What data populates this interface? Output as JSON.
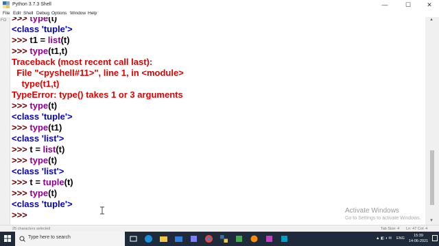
{
  "window": {
    "title": "Python 3.7.3 Shell",
    "minimize": "—",
    "maximize": "☐",
    "close": "✕"
  },
  "menu": [
    "File",
    "Edit",
    "Shell",
    "Debug",
    "Options",
    "Window",
    "Help"
  ],
  "gutter_text": "FO",
  "shell": {
    "lines": [
      {
        "segments": [
          {
            "t": ">>> ",
            "c": "prompt"
          },
          {
            "t": "type",
            "c": "builtin"
          },
          {
            "t": "(t)",
            "c": "code"
          }
        ]
      },
      {
        "segments": [
          {
            "t": "<class 'tuple'>",
            "c": "out"
          }
        ]
      },
      {
        "segments": [
          {
            "t": ">>> ",
            "c": "prompt"
          },
          {
            "t": "t1 = ",
            "c": "code"
          },
          {
            "t": "list",
            "c": "builtin"
          },
          {
            "t": "(t)",
            "c": "code"
          }
        ]
      },
      {
        "segments": [
          {
            "t": ">>> ",
            "c": "prompt"
          },
          {
            "t": "type",
            "c": "builtin"
          },
          {
            "t": "(t1,t)",
            "c": "code"
          }
        ]
      },
      {
        "segments": [
          {
            "t": "Traceback (most recent call last):",
            "c": "err"
          }
        ]
      },
      {
        "segments": [
          {
            "t": "  File \"<pyshell#11>\", line 1, in <module>",
            "c": "err"
          }
        ]
      },
      {
        "segments": [
          {
            "t": "    type(t1,t)",
            "c": "err"
          }
        ]
      },
      {
        "segments": [
          {
            "t": "TypeError: type() takes 1 or 3 arguments",
            "c": "err"
          }
        ]
      },
      {
        "segments": [
          {
            "t": ">>> ",
            "c": "prompt"
          },
          {
            "t": "type",
            "c": "builtin"
          },
          {
            "t": "(t)",
            "c": "code"
          }
        ]
      },
      {
        "segments": [
          {
            "t": "<class 'tuple'>",
            "c": "out"
          }
        ]
      },
      {
        "segments": [
          {
            "t": ">>> ",
            "c": "prompt"
          },
          {
            "t": "type",
            "c": "builtin"
          },
          {
            "t": "(t1)",
            "c": "code"
          }
        ]
      },
      {
        "segments": [
          {
            "t": "<class 'list'>",
            "c": "out"
          }
        ]
      },
      {
        "segments": [
          {
            "t": ">>> ",
            "c": "prompt"
          },
          {
            "t": "t = ",
            "c": "code"
          },
          {
            "t": "list",
            "c": "builtin"
          },
          {
            "t": "(t)",
            "c": "code"
          }
        ]
      },
      {
        "segments": [
          {
            "t": ">>> ",
            "c": "prompt"
          },
          {
            "t": "type",
            "c": "builtin"
          },
          {
            "t": "(t)",
            "c": "code"
          }
        ]
      },
      {
        "segments": [
          {
            "t": "<class 'list'>",
            "c": "out"
          }
        ]
      },
      {
        "segments": [
          {
            "t": ">>> ",
            "c": "prompt"
          },
          {
            "t": "t = ",
            "c": "code"
          },
          {
            "t": "tuple",
            "c": "builtin"
          },
          {
            "t": "(t)",
            "c": "code"
          }
        ]
      },
      {
        "segments": [
          {
            "t": ">>> ",
            "c": "prompt"
          },
          {
            "t": "type",
            "c": "builtin"
          },
          {
            "t": "(t)",
            "c": "code"
          }
        ]
      },
      {
        "segments": [
          {
            "t": "<class 'tuple'>",
            "c": "out"
          }
        ]
      },
      {
        "segments": [
          {
            "t": ">>> ",
            "c": "prompt"
          }
        ]
      }
    ]
  },
  "watermark": {
    "line1": "Activate Windows",
    "line2": "Go to Settings to activate Windows."
  },
  "status": {
    "left": "25 characters selected",
    "tab_size": "Tab Size: 4",
    "position": "Ln: 47  Col: 4"
  },
  "taskbar": {
    "search_placeholder": "Type here to search",
    "icons": [
      "task-view-icon",
      "edge-icon",
      "file-explorer-icon",
      "mail-icon",
      "store-icon",
      "chrome-icon",
      "python-icon",
      "app-icon",
      "app-icon",
      "app-icon"
    ],
    "tray_text": "ENG",
    "time": "15:39",
    "date": "14-06-2021"
  },
  "colors": {
    "prompt": "#700000",
    "builtin": "#900090",
    "output": "#0000c8",
    "error": "#e00000",
    "taskbar": "#1f2b3a"
  }
}
